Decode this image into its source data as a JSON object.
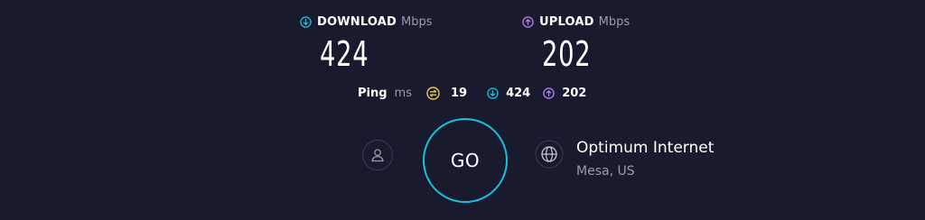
{
  "download": {
    "label": "DOWNLOAD",
    "unit": "Mbps",
    "value": "424",
    "icon": "arrow-down-circle-icon",
    "color": "#1bbfe0"
  },
  "upload": {
    "label": "UPLOAD",
    "unit": "Mbps",
    "value": "202",
    "icon": "arrow-up-circle-icon",
    "color": "#b57cf2"
  },
  "ping": {
    "label": "Ping",
    "unit": "ms",
    "idle_value": "19",
    "idle_icon": "ping-idle-icon",
    "idle_color": "#f3c64e",
    "download_value": "424",
    "upload_value": "202"
  },
  "go_button": {
    "label": "GO",
    "ring_color": "#1bbfe0"
  },
  "user": {
    "icon": "user-icon"
  },
  "provider": {
    "name": "Optimum Internet",
    "location": "Mesa, US",
    "icon": "globe-icon"
  }
}
